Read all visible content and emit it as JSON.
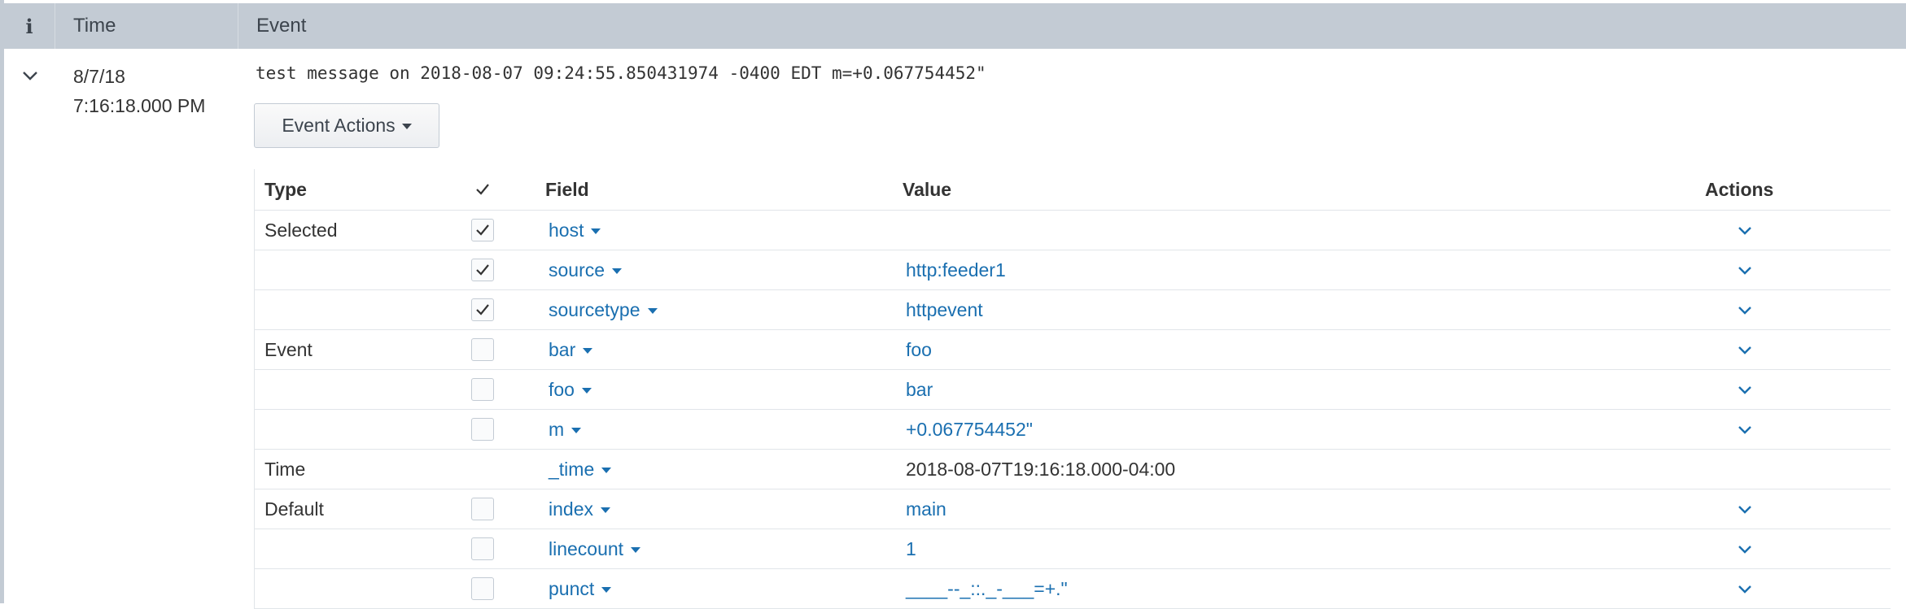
{
  "header": {
    "info_glyph": "i",
    "time_label": "Time",
    "event_label": "Event"
  },
  "event": {
    "date": "8/7/18",
    "time": "7:16:18.000 PM",
    "raw": "test message on 2018-08-07 09:24:55.850431974 -0400 EDT m=+0.067754452\"",
    "actions_label": "Event Actions"
  },
  "fields_table": {
    "headers": {
      "type": "Type",
      "field": "Field",
      "value": "Value",
      "actions": "Actions"
    },
    "rows": [
      {
        "type": "Selected",
        "checked": true,
        "field": "host",
        "value": "",
        "has_actions": true
      },
      {
        "type": "",
        "checked": true,
        "field": "source",
        "value": "http:feeder1",
        "has_actions": true
      },
      {
        "type": "",
        "checked": true,
        "field": "sourcetype",
        "value": "httpevent",
        "has_actions": true
      },
      {
        "type": "Event",
        "checked": false,
        "field": "bar",
        "value": "foo",
        "has_actions": true
      },
      {
        "type": "",
        "checked": false,
        "field": "foo",
        "value": "bar",
        "has_actions": true
      },
      {
        "type": "",
        "checked": false,
        "field": "m",
        "value": "+0.067754452\"",
        "has_actions": true
      },
      {
        "type": "Time",
        "checked": null,
        "field": "_time",
        "value": "2018-08-07T19:16:18.000-04:00",
        "has_actions": false
      },
      {
        "type": "Default",
        "checked": false,
        "field": "index",
        "value": "main",
        "has_actions": true
      },
      {
        "type": "",
        "checked": false,
        "field": "linecount",
        "value": "1",
        "has_actions": true
      },
      {
        "type": "",
        "checked": false,
        "field": "punct",
        "value": "____--_::._-___=+.\"",
        "has_actions": true
      }
    ]
  },
  "colors": {
    "header_bg": "#c3cbd4",
    "link_blue": "#1a6fb0",
    "text": "#333333"
  },
  "icons": {
    "expand": "chevron-down-icon",
    "check": "checkmark-icon",
    "field_menu": "caret-down-icon",
    "row_actions": "chevron-down-icon"
  }
}
